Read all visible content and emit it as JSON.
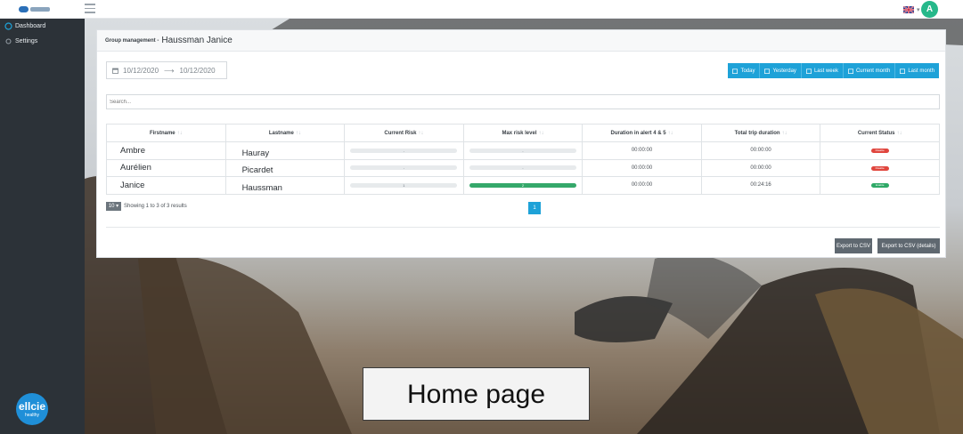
{
  "topbar": {
    "logo": "wellcie-logo",
    "menu_icon": "hamburger-icon",
    "flag": "uk-flag-icon",
    "avatar_initial": "A"
  },
  "sidebar": {
    "items": [
      {
        "label": "Dashboard",
        "icon": "dashboard-icon"
      },
      {
        "label": "Settings",
        "icon": "gear-icon"
      }
    ],
    "brand": {
      "title": "ellcie",
      "subtitle": "healthy"
    }
  },
  "header": {
    "breadcrumb_label": "Group management -",
    "group_name": "Haussman Janice"
  },
  "date_range": {
    "start": "10/12/2020",
    "arrow": "⟶",
    "end": "10/12/2020"
  },
  "quick_ranges": [
    "Today",
    "Yesterday",
    "Last week",
    "Current month",
    "Last month"
  ],
  "search": {
    "placeholder": "Search..."
  },
  "table": {
    "columns": [
      "Firstname",
      "Lastname",
      "Current Risk",
      "Max risk level",
      "Duration in alert 4 & 5",
      "Total trip duration",
      "Current Status"
    ],
    "rows": [
      {
        "firstname": "Ambre",
        "lastname": "Hauray",
        "current_risk": "-",
        "max_risk": "-",
        "duration_alert": "00:00:00",
        "total_trip": "00:00:00",
        "status": "Disable",
        "max_risk_fill": 0
      },
      {
        "firstname": "Aurélien",
        "lastname": "Picardet",
        "current_risk": "-",
        "max_risk": "-",
        "duration_alert": "00:00:00",
        "total_trip": "00:00:00",
        "status": "Disable",
        "max_risk_fill": 0
      },
      {
        "firstname": "Janice",
        "lastname": "Haussman",
        "current_risk": "1",
        "max_risk": "2",
        "duration_alert": "00:00:00",
        "total_trip": "00:24:16",
        "status": "Enable",
        "max_risk_fill": 1
      }
    ]
  },
  "footer": {
    "page_size": "10",
    "results_text": "Showing 1 to 3 of 3 results",
    "page": "1",
    "export_csv": "Export to CSV",
    "export_csv_details": "Export to CSV (details)"
  },
  "caption": "Home page",
  "colors": {
    "accent": "#1ea2d8",
    "sidebar": "#2c3238",
    "success": "#2fa967",
    "danger": "#e0463e",
    "avatar": "#26b88a"
  }
}
